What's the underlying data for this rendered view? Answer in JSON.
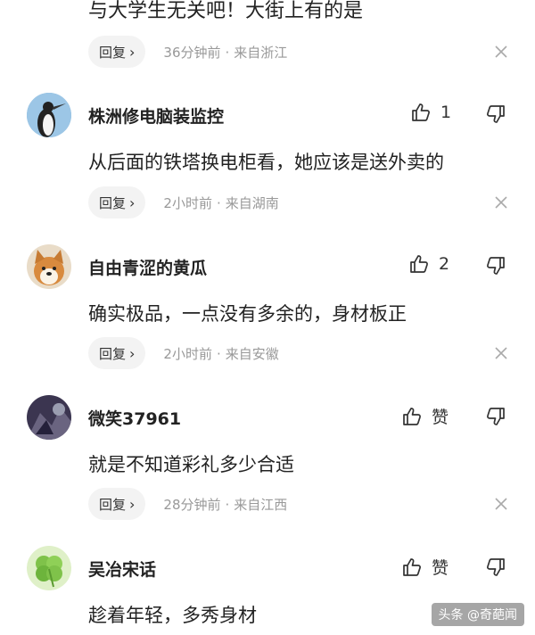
{
  "top_comment": {
    "text": "与大学生无关吧！大街上有的是",
    "reply_label": "回复",
    "time": "36分钟前",
    "location": "来自浙江"
  },
  "comments": [
    {
      "username": "株洲修电脑装监控",
      "like_count": "1",
      "text": "从后面的铁塔换电柜看，她应该是送外卖的",
      "reply_label": "回复",
      "time": "2小时前",
      "location": "来自湖南"
    },
    {
      "username": "自由青涩的黄瓜",
      "like_count": "2",
      "text": "确实极品，一点没有多余的，身材板正",
      "reply_label": "回复",
      "time": "2小时前",
      "location": "来自安徽"
    },
    {
      "username": "微笑37961",
      "like_count": "赞",
      "text": "就是不知道彩礼多少合适",
      "reply_label": "回复",
      "time": "28分钟前",
      "location": "来自江西"
    },
    {
      "username": "吴冶宋话",
      "like_count": "赞",
      "text": "趁着年轻，多秀身材"
    }
  ],
  "watermark": "头条 @奇葩闻",
  "separator": "·",
  "icons": {
    "like": "thumbs-up-icon",
    "dislike": "thumbs-down-icon",
    "close": "close-icon",
    "chevron": "chevron-right-icon"
  }
}
